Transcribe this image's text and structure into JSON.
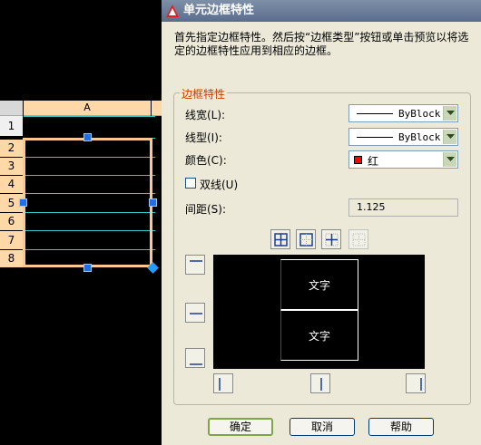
{
  "spreadsheet": {
    "column_header": "A",
    "row_numbers": [
      "1",
      "2",
      "3",
      "4",
      "5",
      "6",
      "7",
      "8"
    ]
  },
  "dialog": {
    "title": "单元边框特性",
    "description": "首先指定边框特性。然后按“边框类型”按钮或单击预览以将选定的边框特性应用到相应的边框。",
    "group_title": "边框特性",
    "lineweight": {
      "label": "线宽(L):",
      "value": "ByBlock"
    },
    "linetype": {
      "label": "线型(I):",
      "value": "ByBlock"
    },
    "color": {
      "label": "颜色(C):",
      "value": "红",
      "swatch": "#ff0000"
    },
    "double_line": {
      "label": "双线(U)",
      "checked": false
    },
    "spacing": {
      "label": "间距(S):",
      "value": "1.125"
    },
    "preview": {
      "cell_texts": [
        "文字",
        "文字"
      ]
    },
    "buttons": {
      "ok": "确定",
      "cancel": "取消",
      "help": "帮助"
    }
  },
  "colors": {
    "dialog_bg": "#ECE9D8",
    "group_title": "#C04000",
    "header_orange": "#FFD8A8",
    "grid_cyan": "#35c6c6",
    "grip_blue": "#1f6fe8"
  }
}
